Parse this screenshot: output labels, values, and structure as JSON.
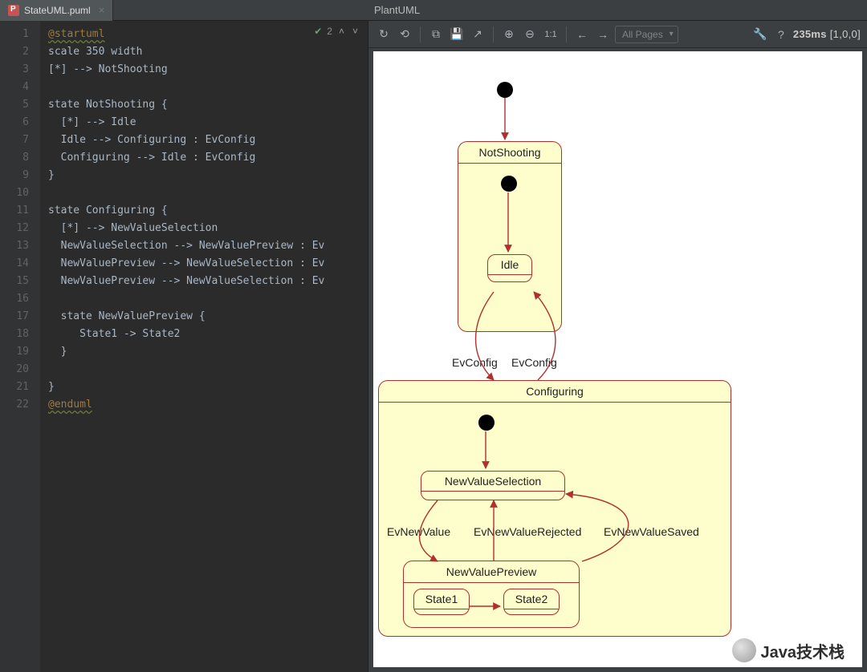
{
  "tab": {
    "filename": "StateUML.puml"
  },
  "panel": {
    "title": "PlantUML"
  },
  "editor": {
    "problems_count": "2",
    "code_lines": [
      {
        "n": 1,
        "cls": "kw-start",
        "t": "@startuml"
      },
      {
        "n": 2,
        "t": "scale 350 width"
      },
      {
        "n": 3,
        "t": "[*] --> NotShooting"
      },
      {
        "n": 4,
        "t": ""
      },
      {
        "n": 5,
        "t": "state NotShooting {"
      },
      {
        "n": 6,
        "t": "  [*] --> Idle"
      },
      {
        "n": 7,
        "t": "  Idle --> Configuring : EvConfig"
      },
      {
        "n": 8,
        "t": "  Configuring --> Idle : EvConfig"
      },
      {
        "n": 9,
        "t": "}"
      },
      {
        "n": 10,
        "t": ""
      },
      {
        "n": 11,
        "t": "state Configuring {"
      },
      {
        "n": 12,
        "t": "  [*] --> NewValueSelection"
      },
      {
        "n": 13,
        "t": "  NewValueSelection --> NewValuePreview : Ev"
      },
      {
        "n": 14,
        "t": "  NewValuePreview --> NewValueSelection : Ev"
      },
      {
        "n": 15,
        "t": "  NewValuePreview --> NewValueSelection : Ev"
      },
      {
        "n": 16,
        "t": ""
      },
      {
        "n": 17,
        "t": "  state NewValuePreview {"
      },
      {
        "n": 18,
        "t": "     State1 -> State2"
      },
      {
        "n": 19,
        "t": "  }"
      },
      {
        "n": 20,
        "t": ""
      },
      {
        "n": 21,
        "t": "}"
      },
      {
        "n": 22,
        "cls": "kw-end",
        "t": "@enduml"
      }
    ]
  },
  "toolbar": {
    "pages_label": "All Pages",
    "status_time": "235ms",
    "status_vec": "[1,0,0]"
  },
  "diagram": {
    "states": {
      "NotShooting": "NotShooting",
      "Idle": "Idle",
      "Configuring": "Configuring",
      "NewValueSelection": "NewValueSelection",
      "NewValuePreview": "NewValuePreview",
      "State1": "State1",
      "State2": "State2"
    },
    "labels": {
      "EvConfig1": "EvConfig",
      "EvConfig2": "EvConfig",
      "EvNewValue": "EvNewValue",
      "EvNewValueRejected": "EvNewValueRejected",
      "EvNewValueSaved": "EvNewValueSaved"
    }
  },
  "watermark": "Java技术栈"
}
